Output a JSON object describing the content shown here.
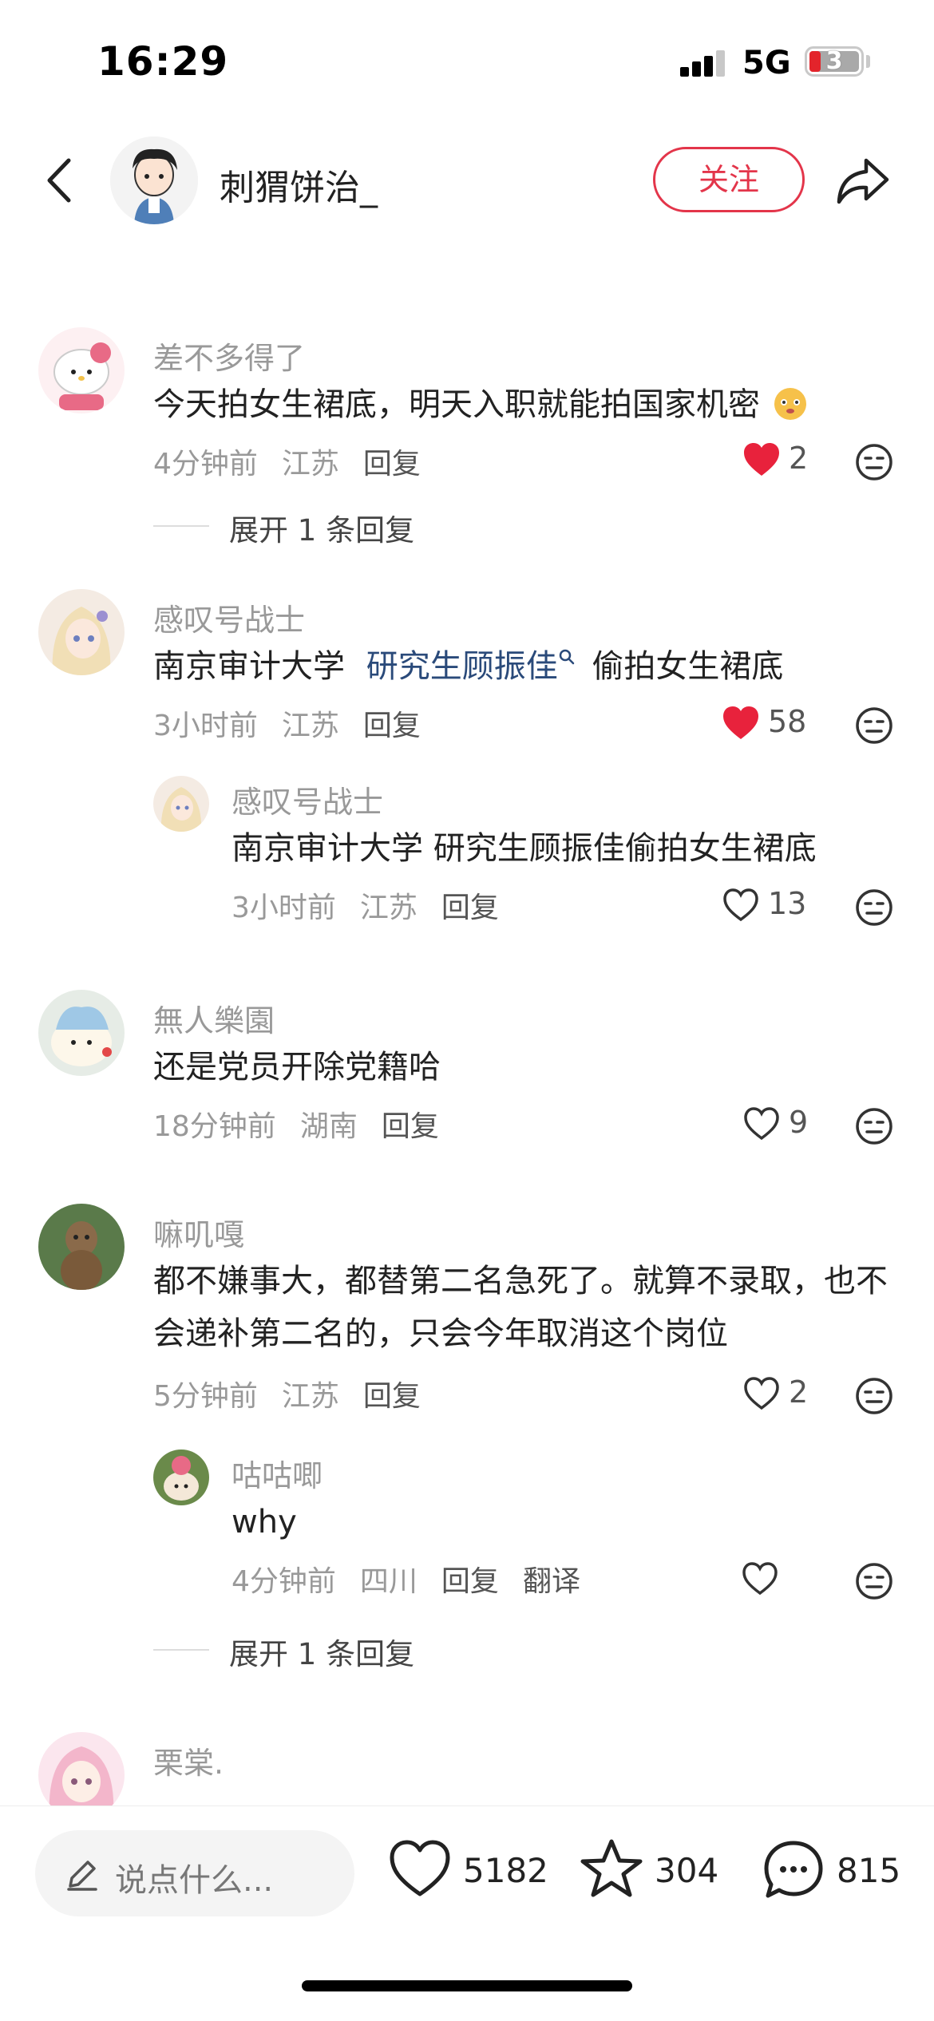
{
  "status_bar": {
    "time": "16:29",
    "network": "5G",
    "battery": "3"
  },
  "header": {
    "author": "刺猬饼治_",
    "follow_label": "关注"
  },
  "comments": [
    {
      "user": "差不多得了",
      "text": "今天拍女生裙底，明天入职就能拍国家机密",
      "time": "4分钟前",
      "region": "江苏",
      "reply": "回复",
      "likes": "2",
      "liked": true,
      "expand": "展开 1 条回复"
    },
    {
      "user": "感叹号战士",
      "text_a": "南京审计大学",
      "text_link": "研究生顾振佳",
      "text_b": "偷拍女生裙底",
      "time": "3小时前",
      "region": "江苏",
      "reply": "回复",
      "likes": "58",
      "liked": true
    },
    {
      "user": "感叹号战士",
      "text": "南京审计大学 研究生顾振佳偷拍女生裙底",
      "time": "3小时前",
      "region": "江苏",
      "reply": "回复",
      "likes": "13",
      "liked": false
    },
    {
      "user": "無人樂園",
      "text": "还是党员开除党籍哈",
      "time": "18分钟前",
      "region": "湖南",
      "reply": "回复",
      "likes": "9",
      "liked": false
    },
    {
      "user": "嘛叽嘎",
      "text": "都不嫌事大，都替第二名急死了。就算不录取，也不会递补第二名的，只会今年取消这个岗位",
      "time": "5分钟前",
      "region": "江苏",
      "reply": "回复",
      "likes": "2",
      "liked": false
    },
    {
      "user": "咕咕唧",
      "text": "why",
      "time": "4分钟前",
      "region": "四川",
      "reply": "回复",
      "translate": "翻译",
      "likes": "",
      "liked": false,
      "expand": "展开 1 条回复"
    },
    {
      "user": "栗棠."
    }
  ],
  "bottom_bar": {
    "placeholder": "说点什么...",
    "likes": "5182",
    "favorites": "304",
    "comments": "815"
  },
  "colors": {
    "accent": "#e3354a",
    "liked": "#e8223c",
    "muted": "#999999"
  }
}
